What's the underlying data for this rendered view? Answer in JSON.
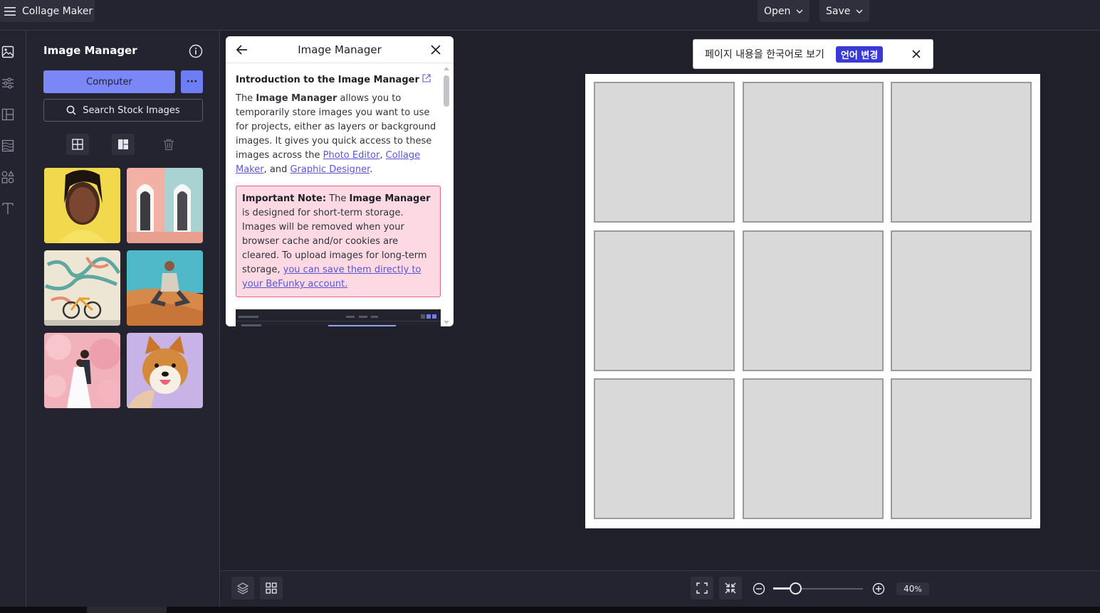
{
  "app": {
    "title": "Collage Maker"
  },
  "topbar": {
    "open_label": "Open",
    "save_label": "Save"
  },
  "rail": {
    "icons": [
      "image-icon",
      "adjust-icon",
      "layout-icon",
      "texture-icon",
      "shapes-icon",
      "text-icon"
    ]
  },
  "panel": {
    "title": "Image Manager",
    "computer_label": "Computer",
    "more_label": "···",
    "search_label": "Search Stock Images",
    "thumbnails": [
      "portrait-woman",
      "pink-doors",
      "mural-bicycle",
      "man-in-desert",
      "wedding-blossoms",
      "shiba-dog"
    ]
  },
  "popup": {
    "title": "Image Manager",
    "intro_heading": "Introduction to the Image Manager",
    "p1_a": "The ",
    "p1_bold": "Image Manager",
    "p1_b": " allows you to temporarily store images you want to use for projects, either as layers or background images. It gives you quick access to these images across the  ",
    "link_photo_editor": "Photo Editor",
    "sep1": ", ",
    "link_collage_maker": "Collage Maker",
    "sep2": ", and ",
    "link_graphic_designer": "Graphic Designer",
    "end": ".",
    "note_label": "Important Note:",
    "note_a": " The ",
    "note_bold": "Image Manager",
    "note_b": " is designed for short-term storage. Images will be removed when your browser cache and/or cookies are cleared. To upload images for long-term storage, ",
    "note_link": "you can save them directly to your BeFunky account."
  },
  "translate": {
    "message": "페이지 내용을 한국어로 보기",
    "button": "언어 변경"
  },
  "canvas": {
    "rows": 3,
    "cols": 3
  },
  "bottombar": {
    "zoom_value": "40",
    "zoom_unit": "%"
  },
  "colors": {
    "accent": "#7b87f7",
    "background": "#1f2029",
    "panel": "#23242f"
  }
}
